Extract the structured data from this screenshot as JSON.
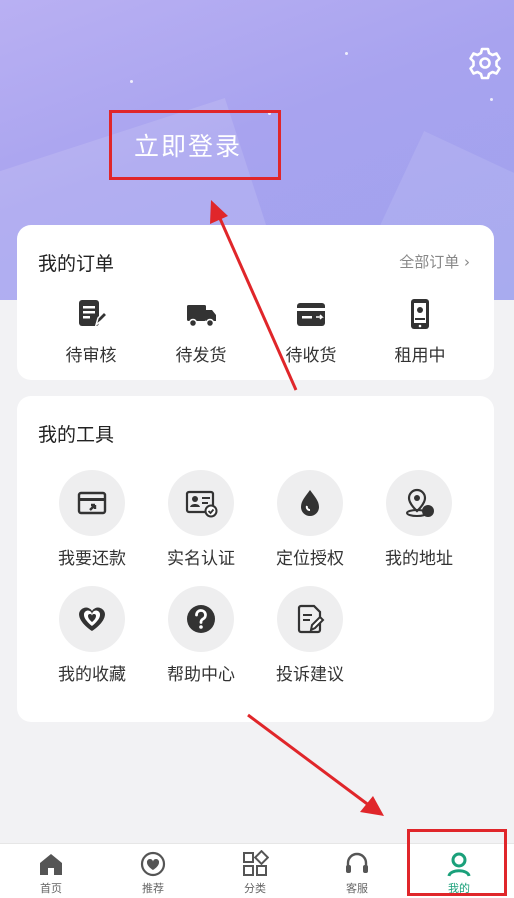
{
  "header": {
    "login_label": "立即登录"
  },
  "orders": {
    "title": "我的订单",
    "all_label": "全部订单",
    "items": [
      {
        "label": "待审核",
        "icon": "pending-review-icon"
      },
      {
        "label": "待发货",
        "icon": "truck-icon"
      },
      {
        "label": "待收货",
        "icon": "receive-box-icon"
      },
      {
        "label": "租用中",
        "icon": "phone-icon"
      }
    ]
  },
  "tools": {
    "title": "我的工具",
    "items": [
      {
        "label": "我要还款",
        "icon": "repay-card-icon"
      },
      {
        "label": "实名认证",
        "icon": "id-card-icon"
      },
      {
        "label": "定位授权",
        "icon": "location-drop-icon"
      },
      {
        "label": "我的地址",
        "icon": "address-icon"
      },
      {
        "label": "我的收藏",
        "icon": "heart-icon"
      },
      {
        "label": "帮助中心",
        "icon": "help-icon"
      },
      {
        "label": "投诉建议",
        "icon": "complaint-icon"
      }
    ]
  },
  "tabbar": {
    "items": [
      {
        "label": "首页",
        "icon": "home-icon"
      },
      {
        "label": "推荐",
        "icon": "recommend-heart-icon"
      },
      {
        "label": "分类",
        "icon": "category-icon"
      },
      {
        "label": "客服",
        "icon": "headset-icon"
      },
      {
        "label": "我的",
        "icon": "profile-icon"
      }
    ],
    "active_index": 4
  },
  "colors": {
    "accent": "#1aa07a",
    "annotation": "#e0262a",
    "header": "#a9a4ef"
  }
}
